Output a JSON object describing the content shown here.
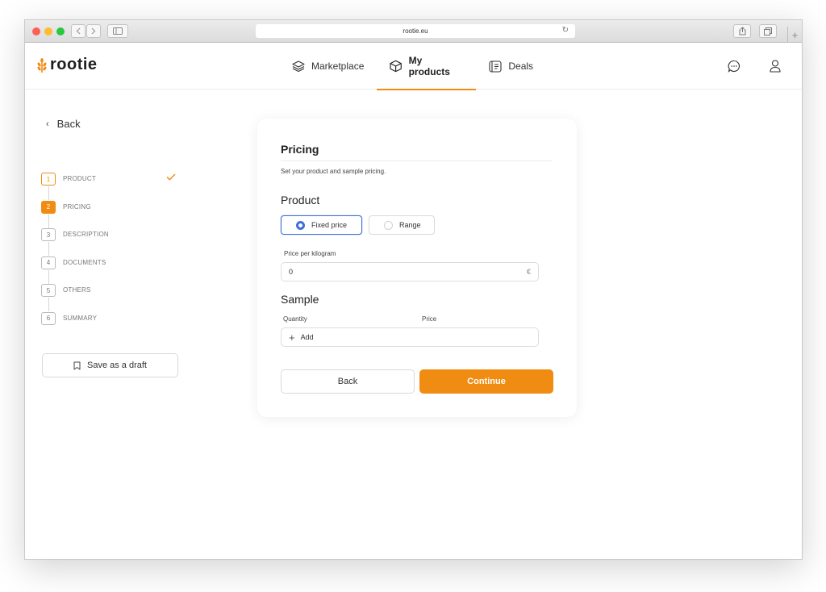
{
  "browser": {
    "url": "rootie.eu"
  },
  "app": {
    "logo_text": "rootie",
    "brand_color": "#f08c12",
    "nav": [
      {
        "label": "Marketplace",
        "icon": "layers-icon",
        "active": false
      },
      {
        "label": "My products",
        "icon": "box-icon",
        "active": true
      },
      {
        "label": "Deals",
        "icon": "deals-icon",
        "active": false
      }
    ]
  },
  "sidebar": {
    "back_label": "Back",
    "steps": [
      {
        "num": "1",
        "label": "PRODUCT",
        "status": "done"
      },
      {
        "num": "2",
        "label": "PRICING",
        "status": "active"
      },
      {
        "num": "3",
        "label": "DESCRIPTION",
        "status": "pending"
      },
      {
        "num": "4",
        "label": "DOCUMENTS",
        "status": "pending"
      },
      {
        "num": "5",
        "label": "OTHERS",
        "status": "pending"
      },
      {
        "num": "6",
        "label": "SUMMARY",
        "status": "pending"
      }
    ],
    "draft_label": "Save as a draft"
  },
  "form": {
    "title": "Pricing",
    "subtitle": "Set your product and sample pricing.",
    "product_section": "Product",
    "pricing_options": [
      {
        "label": "Fixed price",
        "selected": true
      },
      {
        "label": "Range",
        "selected": false
      }
    ],
    "price_label": "Price per kilogram",
    "price_value": "0",
    "currency": "€",
    "sample_section": "Sample",
    "sample_columns": [
      "Quantity",
      "Price"
    ],
    "add_label": "Add",
    "back_button": "Back",
    "continue_button": "Continue"
  }
}
